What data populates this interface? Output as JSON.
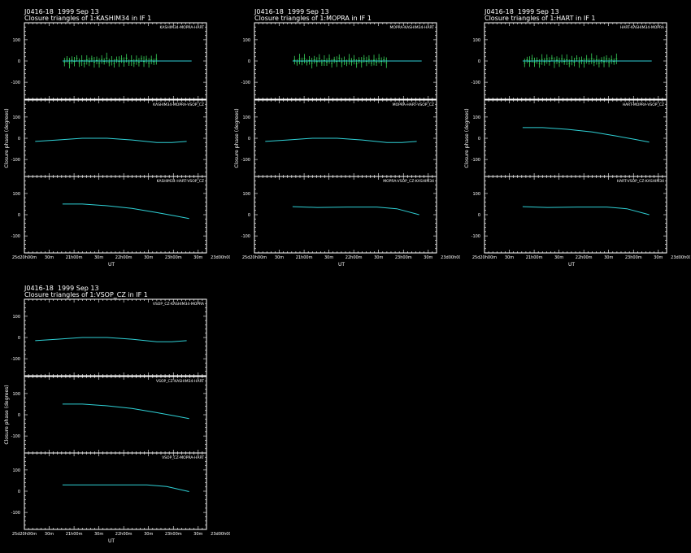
{
  "colors": {
    "background": "#000000",
    "axes": "#ffffff",
    "model_line": "#2fd1d6",
    "data": "#38d45a"
  },
  "chart_data": [
    {
      "type": "line",
      "title": "J0416-18  1999 Sep 13",
      "subtitle": "Closure triangles of 1:KASHIM34 in IF 1",
      "ylabel": "Closure phase   (degrees)",
      "xlabel": "UT",
      "x_ticks": [
        "25d20h00m",
        "30m",
        "21h00m",
        "30m",
        "22h00m",
        "30m",
        "23h00m",
        "30m",
        "23d00h00m"
      ],
      "xlim": [
        20.333,
        24.0
      ],
      "y_ticks": [
        100,
        0,
        -100
      ],
      "ylim": [
        -180,
        180
      ],
      "panels": [
        {
          "name": "KASHIM34-MOPRA-HART",
          "line": {
            "x": [
              21.1,
              23.7
            ],
            "y": [
              0,
              0
            ]
          },
          "points": {
            "x": [
              21.14,
              21.19,
              21.24,
              21.29,
              21.34,
              21.39,
              21.44,
              21.49,
              21.54,
              21.59,
              21.64,
              21.69,
              21.74,
              21.79,
              21.84,
              21.89,
              21.94,
              21.99,
              22.04,
              22.09,
              22.14,
              22.19,
              22.24,
              22.29,
              22.34,
              22.39,
              22.44,
              22.49,
              22.54,
              22.59,
              22.64,
              22.69,
              22.74,
              22.79,
              22.84,
              22.89,
              22.94,
              22.99
            ],
            "y": [
              -5,
              8,
              -10,
              4,
              -3,
              12,
              -8,
              2,
              -12,
              5,
              -4,
              10,
              -6,
              3,
              -9,
              7,
              -2,
              14,
              -7,
              1,
              -11,
              6,
              -3,
              9,
              -5,
              13,
              -8,
              2,
              -10,
              4,
              -6,
              11,
              -3,
              7,
              -9,
              5,
              -4,
              8
            ],
            "err": [
              20,
              15,
              25,
              18,
              22,
              15,
              20,
              25,
              18,
              22,
              20,
              15,
              25,
              18,
              22,
              20,
              15,
              25,
              18,
              22,
              20,
              15,
              25,
              18,
              22,
              20,
              15,
              25,
              18,
              22,
              20,
              15,
              25,
              18,
              22,
              20,
              15,
              25
            ]
          }
        },
        {
          "name": "KASHIM34-MOPRA-VSOP_CZ",
          "line": {
            "x": [
              20.55,
              21.0,
              21.5,
              22.0,
              22.5,
              23.0,
              23.3,
              23.6
            ],
            "y": [
              -15,
              -8,
              0,
              0,
              -8,
              -20,
              -20,
              -15
            ]
          },
          "points": null
        },
        {
          "name": "KASHIM34-HART-VSOP_CZ",
          "line": {
            "x": [
              21.1,
              21.5,
              22.0,
              22.5,
              23.0,
              23.35,
              23.65
            ],
            "y": [
              50,
              50,
              42,
              30,
              10,
              -5,
              -18
            ]
          },
          "points": null
        }
      ]
    },
    {
      "type": "line",
      "title": "J0416-18  1999 Sep 13",
      "subtitle": "Closure triangles of 1:MOPRA in IF 1",
      "ylabel": "Closure phase   (degrees)",
      "xlabel": "UT",
      "x_ticks": [
        "25d20h00m",
        "30m",
        "21h00m",
        "30m",
        "22h00m",
        "30m",
        "23h00m",
        "30m",
        "23d00h00m"
      ],
      "xlim": [
        20.333,
        24.0
      ],
      "y_ticks": [
        100,
        0,
        -100
      ],
      "ylim": [
        -180,
        180
      ],
      "panels": [
        {
          "name": "MOPRA-KASHIM34-HART",
          "line": {
            "x": [
              21.1,
              23.7
            ],
            "y": [
              0,
              0
            ]
          },
          "points": {
            "x": [
              21.14,
              21.19,
              21.24,
              21.29,
              21.34,
              21.39,
              21.44,
              21.49,
              21.54,
              21.59,
              21.64,
              21.69,
              21.74,
              21.79,
              21.84,
              21.89,
              21.94,
              21.99,
              22.04,
              22.09,
              22.14,
              22.19,
              22.24,
              22.29,
              22.34,
              22.39,
              22.44,
              22.49,
              22.54,
              22.59,
              22.64,
              22.69,
              22.74,
              22.79,
              22.84,
              22.89,
              22.94,
              22.99
            ],
            "y": [
              4,
              -7,
              9,
              -2,
              11,
              -6,
              3,
              -10,
              6,
              -4,
              12,
              -8,
              2,
              -5,
              9,
              -11,
              5,
              -3,
              13,
              -7,
              1,
              -9,
              8,
              -4,
              6,
              -12,
              3,
              -6,
              10,
              -2,
              7,
              -9,
              4,
              -5,
              11,
              -3,
              6,
              -8
            ],
            "err": [
              20,
              15,
              25,
              18,
              22,
              15,
              20,
              25,
              18,
              22,
              20,
              15,
              25,
              18,
              22,
              20,
              15,
              25,
              18,
              22,
              20,
              15,
              25,
              18,
              22,
              20,
              15,
              25,
              18,
              22,
              20,
              15,
              25,
              18,
              22,
              20,
              15,
              25
            ]
          }
        },
        {
          "name": "MOPRA-HART-VSOP_CZ",
          "line": {
            "x": [
              20.55,
              21.0,
              21.5,
              22.0,
              22.5,
              23.0,
              23.3,
              23.6
            ],
            "y": [
              -15,
              -8,
              0,
              0,
              -8,
              -20,
              -20,
              -15
            ]
          },
          "points": null
        },
        {
          "name": "MOPRA-VSOP_CZ-KASHIM34",
          "line": {
            "x": [
              21.1,
              21.6,
              22.2,
              22.8,
              23.2,
              23.65
            ],
            "y": [
              38,
              34,
              36,
              36,
              28,
              0
            ]
          },
          "points": null
        }
      ]
    },
    {
      "type": "line",
      "title": "J0416-18  1999 Sep 13",
      "subtitle": "Closure triangles of 1:HART in IF 1",
      "ylabel": "Closure phase   (degrees)",
      "xlabel": "UT",
      "x_ticks": [
        "25d20h00m",
        "30m",
        "21h00m",
        "30m",
        "22h00m",
        "30m",
        "23h00m",
        "30m",
        "23d00h00m"
      ],
      "xlim": [
        20.333,
        24.0
      ],
      "y_ticks": [
        100,
        0,
        -100
      ],
      "ylim": [
        -180,
        180
      ],
      "panels": [
        {
          "name": "HART-KASHIM34-MOPRA",
          "line": {
            "x": [
              21.1,
              23.7
            ],
            "y": [
              0,
              0
            ]
          },
          "points": {
            "x": [
              21.14,
              21.19,
              21.24,
              21.29,
              21.34,
              21.39,
              21.44,
              21.49,
              21.54,
              21.59,
              21.64,
              21.69,
              21.74,
              21.79,
              21.84,
              21.89,
              21.94,
              21.99,
              22.04,
              22.09,
              22.14,
              22.19,
              22.24,
              22.29,
              22.34,
              22.39,
              22.44,
              22.49,
              22.54,
              22.59,
              22.64,
              22.69,
              22.74,
              22.79,
              22.84,
              22.89,
              22.94,
              22.99
            ],
            "y": [
              -9,
              5,
              -3,
              11,
              -6,
              2,
              -12,
              7,
              -4,
              9,
              -2,
              13,
              -8,
              4,
              -6,
              10,
              -3,
              6,
              -11,
              2,
              -5,
              12,
              -7,
              3,
              -9,
              8,
              -2,
              11,
              -6,
              5,
              -10,
              3,
              -4,
              9,
              -7,
              6,
              -3,
              10
            ],
            "err": [
              20,
              15,
              25,
              18,
              22,
              15,
              20,
              25,
              18,
              22,
              20,
              15,
              25,
              18,
              22,
              20,
              15,
              25,
              18,
              22,
              20,
              15,
              25,
              18,
              22,
              20,
              15,
              25,
              18,
              22,
              20,
              15,
              25,
              18,
              22,
              20,
              15,
              25
            ]
          }
        },
        {
          "name": "HART-MOPRA-VSOP_CZ",
          "line": {
            "x": [
              21.1,
              21.5,
              22.0,
              22.5,
              23.0,
              23.35,
              23.65
            ],
            "y": [
              50,
              50,
              42,
              30,
              10,
              -5,
              -18
            ]
          },
          "points": null
        },
        {
          "name": "HART-VSOP_CZ-KASHIM34",
          "line": {
            "x": [
              21.1,
              21.6,
              22.2,
              22.8,
              23.2,
              23.65
            ],
            "y": [
              38,
              34,
              36,
              36,
              28,
              0
            ]
          },
          "points": null
        }
      ]
    },
    {
      "type": "line",
      "title": "J0416-18  1999 Sep 13",
      "subtitle": "Closure triangles of 1:VSOP_CZ in IF 1",
      "ylabel": "Closure phase   (degrees)",
      "xlabel": "UT",
      "x_ticks": [
        "25d20h00m",
        "30m",
        "21h00m",
        "30m",
        "22h00m",
        "30m",
        "23h00m",
        "30m",
        "23d00h00m"
      ],
      "xlim": [
        20.333,
        24.0
      ],
      "y_ticks": [
        100,
        0,
        -100
      ],
      "ylim": [
        -180,
        180
      ],
      "panels": [
        {
          "name": "VSOP_CZ-KASHIM34-MOPRA",
          "line": {
            "x": [
              20.55,
              21.0,
              21.5,
              22.0,
              22.5,
              23.0,
              23.3,
              23.6
            ],
            "y": [
              -15,
              -8,
              0,
              0,
              -8,
              -20,
              -20,
              -15
            ]
          },
          "points": null
        },
        {
          "name": "VSOP_CZ-KASHIM34-HART",
          "line": {
            "x": [
              21.1,
              21.5,
              22.0,
              22.5,
              23.0,
              23.35,
              23.65
            ],
            "y": [
              50,
              50,
              42,
              30,
              10,
              -5,
              -18
            ]
          },
          "points": null
        },
        {
          "name": "VSOP_CZ-MOPRA-HART",
          "line": {
            "x": [
              21.1,
              21.6,
              22.2,
              22.8,
              23.2,
              23.65
            ],
            "y": [
              30,
              30,
              30,
              30,
              22,
              -2
            ]
          },
          "points": null
        }
      ]
    }
  ]
}
